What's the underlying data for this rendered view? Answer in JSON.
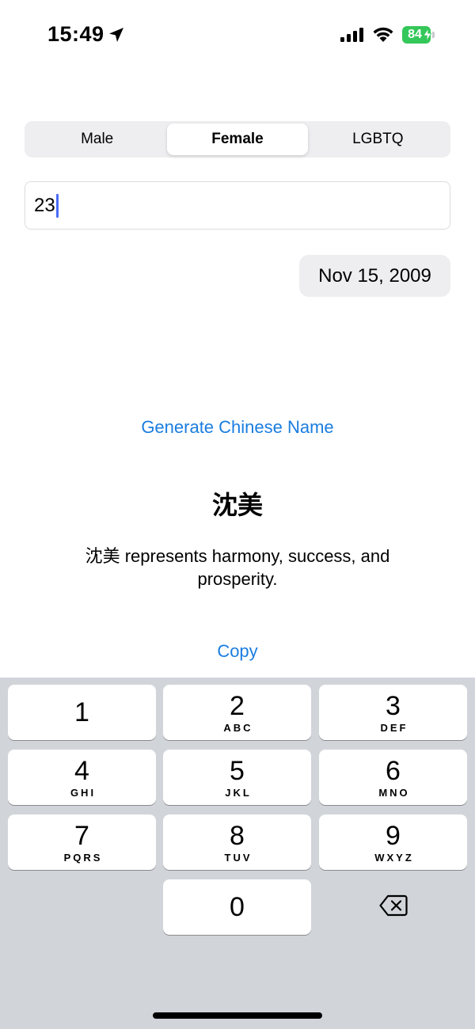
{
  "status_bar": {
    "time": "15:49",
    "battery_level": "84",
    "battery_color": "#34c759"
  },
  "gender_selector": {
    "options": [
      "Male",
      "Female",
      "LGBTQ"
    ],
    "selected": "Female"
  },
  "age_input": {
    "value": "23"
  },
  "birth_date": {
    "value": "Nov 15, 2009"
  },
  "actions": {
    "generate_label": "Generate Chinese Name",
    "copy_label": "Copy",
    "accent_color": "#1a7de0"
  },
  "result": {
    "name": "沈美",
    "description": "沈美 represents harmony, success, and prosperity."
  },
  "keypad": {
    "keys": [
      {
        "digit": "1",
        "letters": ""
      },
      {
        "digit": "2",
        "letters": "ABC"
      },
      {
        "digit": "3",
        "letters": "DEF"
      },
      {
        "digit": "4",
        "letters": "GHI"
      },
      {
        "digit": "5",
        "letters": "JKL"
      },
      {
        "digit": "6",
        "letters": "MNO"
      },
      {
        "digit": "7",
        "letters": "PQRS"
      },
      {
        "digit": "8",
        "letters": "TUV"
      },
      {
        "digit": "9",
        "letters": "WXYZ"
      },
      {
        "digit": "0",
        "letters": ""
      }
    ],
    "delete_icon": "delete-backspace-icon"
  }
}
